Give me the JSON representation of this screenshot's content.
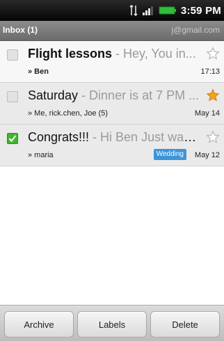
{
  "status_bar": {
    "time": "3:59 PM",
    "icons": [
      "data-transfer-icon",
      "signal-bars-icon",
      "battery-icon"
    ]
  },
  "inbox": {
    "title": "Inbox (1)",
    "account": "j@gmail.com"
  },
  "messages": [
    {
      "subject": "Flight lessons",
      "snippet": " - Hey, You in...",
      "from": "» Ben",
      "date": "17:13",
      "unread": true,
      "checked": false,
      "starred": false
    },
    {
      "subject": "Saturday",
      "snippet": " - Dinner is at 7 PM ...",
      "from": "» Me, rick.chen, Joe (5)",
      "date": "May 14",
      "unread": false,
      "checked": false,
      "starred": true
    },
    {
      "subject": "Congrats!!!",
      "snippet": " - Hi Ben Just want...",
      "from": "» maria",
      "date": "May 12",
      "label": "Wedding",
      "unread": false,
      "checked": true,
      "starred": false
    }
  ],
  "actions": {
    "archive": "Archive",
    "labels": "Labels",
    "delete": "Delete"
  },
  "colors": {
    "accent_checked": "#3fb62b",
    "star_on": "#f3a21b",
    "label_chip": "#3d95d8"
  }
}
